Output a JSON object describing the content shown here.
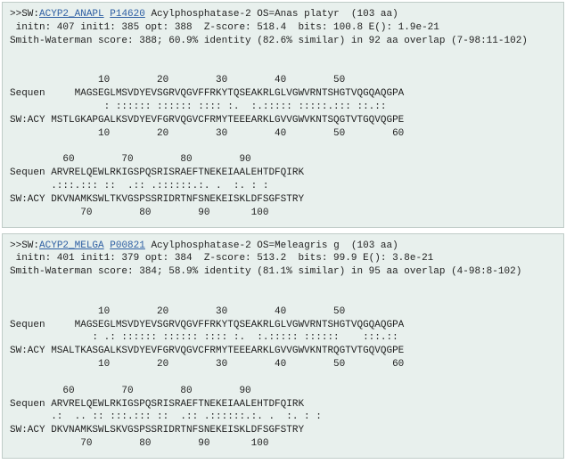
{
  "results": [
    {
      "prefix": ">>SW:",
      "id_link": "ACYP2_ANAPL",
      "acc_link": "P14620",
      "desc": " Acylphosphatase-2 OS=Anas platyr  (103 aa)",
      "score_line1": " initn: 407 init1: 385 opt: 388  Z-score: 518.4  bits: 100.8 E(): 1.9e-21",
      "score_line2": "Smith-Waterman score: 388; 60.9% identity (82.6% similar) in 92 aa overlap (7-98:11-102)",
      "ruler_top1": "               10        20        30        40        50       ",
      "query1": "Sequen     MAGSEGLMSVDYEVSGRVQGVFFRKYTQSEAKRLGLVGWVRNTSHGTVQGQAQGPA",
      "match1": "                : :::::: :::::: :::: :.  :.::::: :::::.::: ::.::",
      "subject1": "SW:ACY MSTLGKAPGALKSVDYEVFGRVQGVCFRMYTEEEARKLGVVGWVKNTSQGTVTGQVQGPE",
      "ruler_bot1": "               10        20        30        40        50        60",
      "ruler_top2": "         60        70        80        90",
      "query2": "Sequen ARVRELQEWLRKIGSPQSRISRAEFTNEKEIAALEHTDFQIRK",
      "match2": "       .:::.::: ::  .:: .::::::.:. .  :. : :",
      "subject2": "SW:ACY DKVNAMKSWLTKVGSPSSRIDRTNFSNEKEISKLDFSGFSTRY",
      "ruler_bot2": "            70        80        90       100"
    },
    {
      "prefix": ">>SW:",
      "id_link": "ACYP2_MELGA",
      "acc_link": "P00821",
      "desc": " Acylphosphatase-2 OS=Meleagris g  (103 aa)",
      "score_line1": " initn: 401 init1: 379 opt: 384  Z-score: 513.2  bits: 99.9 E(): 3.8e-21",
      "score_line2": "Smith-Waterman score: 384; 58.9% identity (81.1% similar) in 95 aa overlap (4-98:8-102)",
      "ruler_top1": "               10        20        30        40        50       ",
      "query1": "Sequen     MAGSEGLMSVDYEVSGRVQGVFFRKYTQSEAKRLGLVGWVRNTSHGTVQGQAQGPA",
      "match1": "              : .: :::::: :::::: :::: :.  :.::::: ::::::    :::.::",
      "subject1": "SW:ACY MSALTKASGALKSVDYEVFGRVQGVCFRMYTEEEARKLGVVGWVKNTRQGTVTGQVQGPE",
      "ruler_bot1": "               10        20        30        40        50        60",
      "ruler_top2": "         60        70        80        90",
      "query2": "Sequen ARVRELQEWLRKIGSPQSRISRAEFTNEKEIAALEHTDFQIRK",
      "match2": "       .:  .. :: :::.::: ::  .:: .::::::.:. .  :. : :",
      "subject2": "SW:ACY DKVNAMKSWLSKVGSPSSRIDRTNFSNEKEISKLDFSGFSTRY",
      "ruler_bot2": "            70        80        90       100"
    }
  ]
}
